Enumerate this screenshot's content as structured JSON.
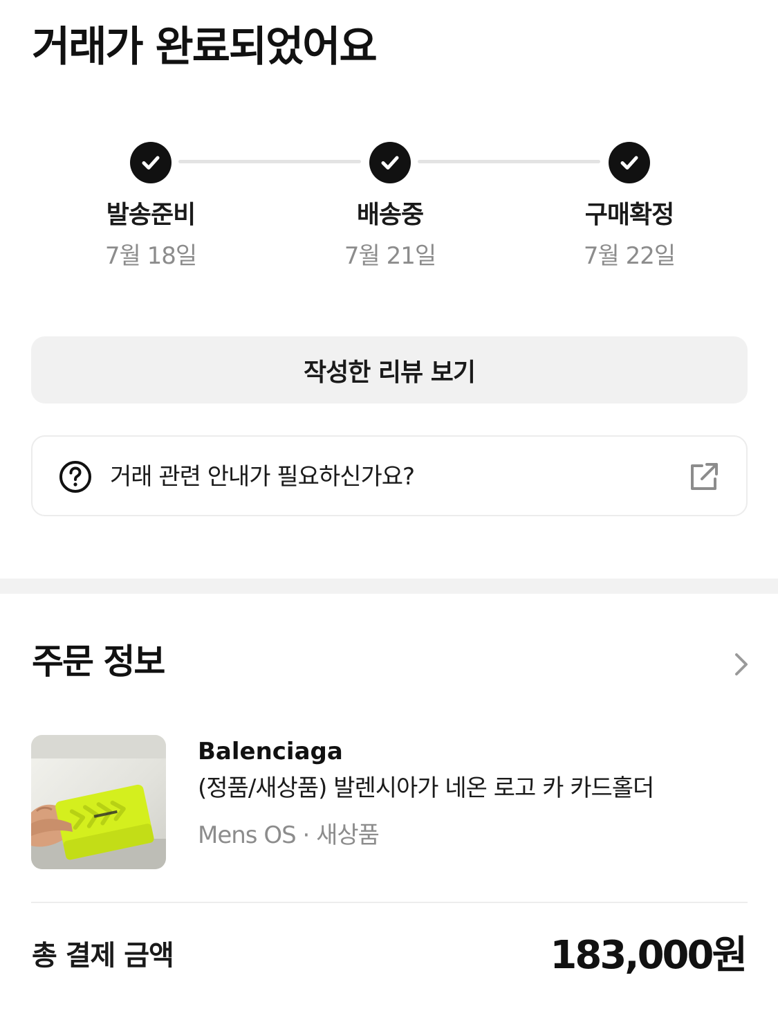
{
  "page_title": "거래가 완료되었어요",
  "steps": [
    {
      "label": "발송준비",
      "date": "7월 18일",
      "status": "done"
    },
    {
      "label": "배송중",
      "date": "7월 21일",
      "status": "done"
    },
    {
      "label": "구매확정",
      "date": "7월 22일",
      "status": "done"
    }
  ],
  "review_button_label": "작성한 리뷰 보기",
  "help": {
    "text": "거래 관련 안내가 필요하신가요?",
    "icon": "question-circle-icon",
    "link_icon": "external-link-icon"
  },
  "order": {
    "section_title": "주문 정보",
    "chevron_icon": "chevron-right-icon",
    "product": {
      "brand": "Balenciaga",
      "title": "(정품/새상품) 발렌시아가 네온 로고 카 카드홀더",
      "meta": "Mens OS · 새상품",
      "thumbnail_color": "#d8f22a"
    },
    "total_label": "총 결제 금액",
    "total_amount": "183,000원"
  },
  "colors": {
    "check_fill": "#111111",
    "connector": "#e3e3e3",
    "button_bg": "#f1f1f1",
    "muted_text": "#8c8c8c"
  }
}
